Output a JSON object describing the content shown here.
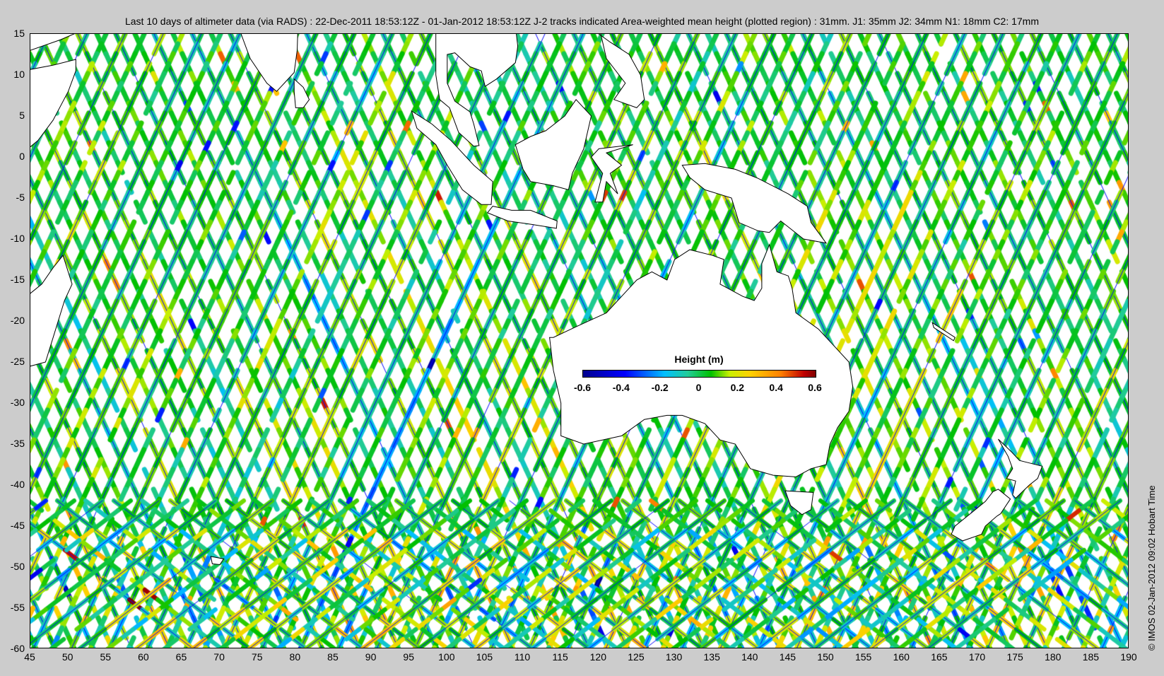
{
  "title": "Last 10 days of altimeter data (via RADS) : 22-Dec-2011 18:53:12Z - 01-Jan-2012 18:53:12Z  J-2 tracks indicated  Area-weighted mean height (plotted region) : 31mm.  J1: 35mm  J2: 34mm  N1: 18mm  C2: 17mm",
  "copyright": "© IMOS 02-Jan-2012 09:02 Hobart Time",
  "axes": {
    "lon_range": [
      45,
      190
    ],
    "lat_range": [
      -60,
      15
    ],
    "x_ticks": [
      "45",
      "50",
      "55",
      "60",
      "65",
      "70",
      "75",
      "80",
      "85",
      "90",
      "95",
      "100",
      "105",
      "110",
      "115",
      "120",
      "125",
      "130",
      "135",
      "140",
      "145",
      "150",
      "155",
      "160",
      "165",
      "170",
      "175",
      "180",
      "185",
      "190"
    ],
    "y_ticks": [
      "15",
      "10",
      "5",
      "0",
      "-5",
      "-10",
      "-15",
      "-20",
      "-25",
      "-30",
      "-35",
      "-40",
      "-45",
      "-50",
      "-55",
      "-60"
    ]
  },
  "colorbar": {
    "title": "Height (m)",
    "range": [
      -0.6,
      0.6
    ],
    "ticks": [
      "-0.6",
      "-0.4",
      "-0.2",
      "0",
      "0.2",
      "0.4",
      "0.6"
    ]
  },
  "colors": {
    "background": "#cccccc",
    "j2_track": "#0000ff",
    "coast": "#000000"
  }
}
